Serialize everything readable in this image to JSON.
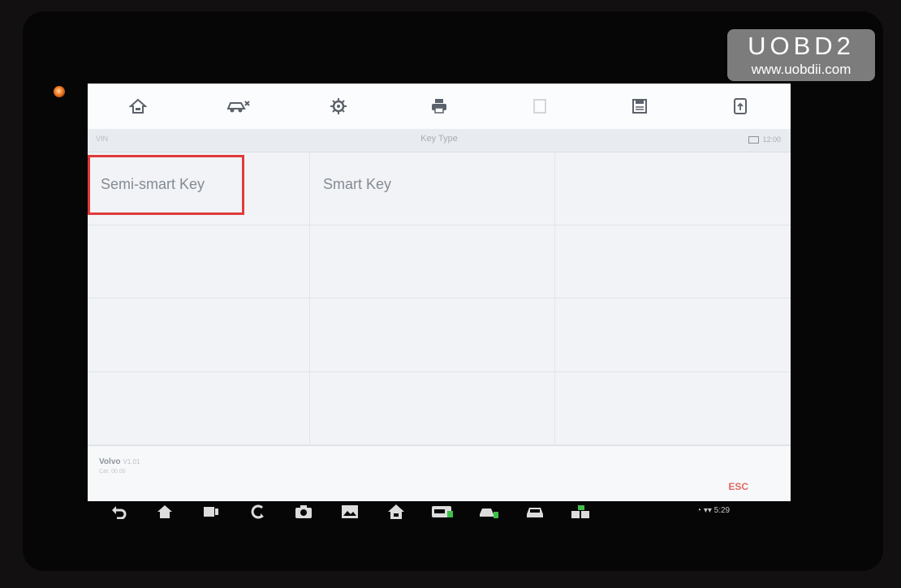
{
  "watermark": {
    "brand": "UOBD2",
    "url": "www.uobdii.com"
  },
  "toolbar": {
    "icons": [
      "home-icon",
      "car-diagnostics-icon",
      "gear-icon",
      "print-icon",
      "help-icon",
      "save-icon",
      "export-icon"
    ]
  },
  "subheader": {
    "left": "VIN",
    "title": "Key Type",
    "right": "12:00"
  },
  "key_types": [
    {
      "label": "Semi-smart Key",
      "selected": true
    },
    {
      "label": "Smart Key",
      "selected": false
    }
  ],
  "footer": {
    "brand": "Volvo",
    "version": "V1.01",
    "sub": "Car: 00.00"
  },
  "esc_label": "ESC",
  "navbar": {
    "icons": [
      "back-icon",
      "home-icon",
      "recent-apps-icon",
      "browser-icon",
      "camera-icon",
      "gallery-icon",
      "autel-home-icon",
      "vci-icon",
      "car-service-icon",
      "car-icon",
      "remote-support-icon"
    ]
  },
  "status": {
    "time": "5:29"
  },
  "colors": {
    "highlight": "#e03a3a",
    "esc": "#e06a63",
    "accent_icon": "#3fbf4a"
  }
}
